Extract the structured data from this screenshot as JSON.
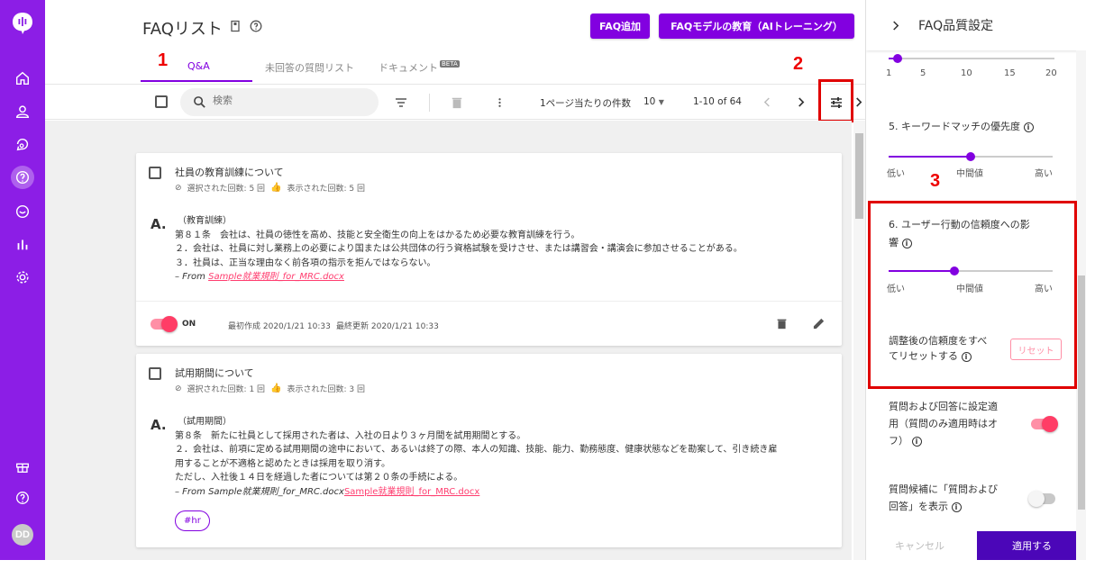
{
  "page": {
    "title": "FAQリスト",
    "add_faq": "FAQ追加",
    "train": "FAQモデルの教育（AIトレーニング）"
  },
  "tabs": [
    {
      "label": "Q&A"
    },
    {
      "label": "未回答の質問リスト"
    },
    {
      "label": "ドキュメント",
      "badge": "BETA"
    }
  ],
  "annotations": {
    "n1": "1",
    "n2": "2",
    "n3": "3"
  },
  "toolbar": {
    "search_placeholder": "検索",
    "per_page_label": "1ページ当たりの件数",
    "per_page_value": "10",
    "range": "1-10 of 64"
  },
  "cards": [
    {
      "question": "社員の教育訓練について",
      "selected": "選択された回数: 5 回",
      "shown": "表示された回数: 5 回",
      "answer_lines": [
        "（教育訓練）",
        "第８１条　会社は、社員の徳性を高め、技能と安全衛生の向上をはかるため必要な教育訓練を行う。",
        "２．会社は、社員に対し業務上の必要により国または公共団体の行う資格試験を受けさせ、または講習会・講演会に参加させることがある。",
        "３．社員は、正当な理由なく前各項の指示を拒んではならない。"
      ],
      "from_prefix": "– From ",
      "from_link": "Sample就業規則_for_MRC.docx",
      "status": "ON",
      "created": "最初作成 2020/1/21 10:33",
      "updated": "最終更新 2020/1/21 10:33"
    },
    {
      "question": "試用期間について",
      "selected": "選択された回数: 1 回",
      "shown": "表示された回数: 3 回",
      "answer_lines": [
        "（試用期間）",
        "第８条　新たに社員として採用された者は、入社の日より３ヶ月間を試用期間とする。",
        "２．会社は、前項に定める試用期間の途中において、あるいは終了の際、本人の知識、技能、能力、勤務態度、健康状態などを勘案して、引き続き雇",
        "用することが不適格と認めたときは採用を取り消す。",
        "ただし、入社後１４日を経過した者については第２０条の手続による。"
      ],
      "from_prefix": "– From Sample就業規則_for_MRC.docx",
      "from_link": "Sample就業規則_for_MRC.docx",
      "tag": "#hr"
    }
  ],
  "panel": {
    "title": "FAQ品質設定",
    "top_slider_ticks": [
      "1",
      "5",
      "10",
      "15",
      "20"
    ],
    "top_slider_value": 2,
    "item5_label": "5. キーワードマッチの優先度",
    "item5_value": 0.5,
    "item6_label_1": "6. ユーザー行動の信頼度への影",
    "item6_label_2": "響",
    "item6_value": 0.4,
    "low": "低い",
    "mid": "中間値",
    "high": "高い",
    "reset_text_1": "調整後の信頼度をすべ",
    "reset_text_2": "てリセットする",
    "reset_button": "リセット",
    "apply_both_1": "質問および回答に設定適",
    "apply_both_2": "用（質問のみ適用時はオ",
    "apply_both_3": "フ）",
    "show_both_1": "質問候補に「質問および",
    "show_both_2": "回答」を表示",
    "cancel": "キャンセル",
    "apply": "適用する"
  },
  "user": {
    "initials": "DD"
  },
  "colors": {
    "brand": "#8200e0",
    "sidebar": "#8c1ee6",
    "accent": "#ff3d66",
    "annotation": "#e00000"
  }
}
